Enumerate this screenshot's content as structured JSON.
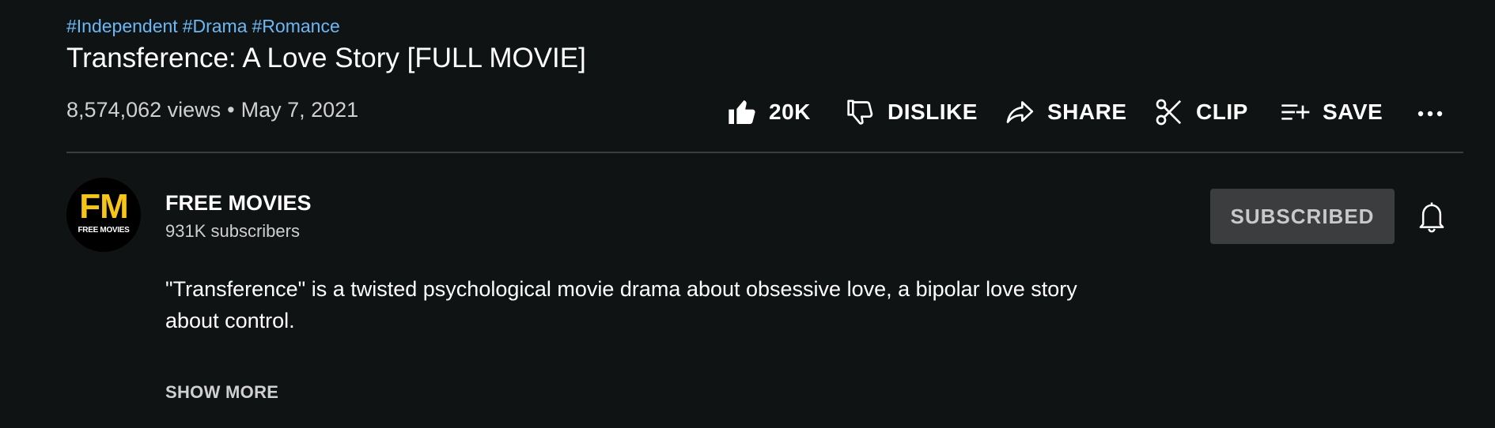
{
  "video": {
    "hashtags": [
      "#Independent",
      "#Drama",
      "#Romance"
    ],
    "title": "Transference: A Love Story [FULL MOVIE]",
    "views": "8,574,062 views",
    "separator": "•",
    "date": "May 7, 2021"
  },
  "actions": {
    "like": {
      "label": "20K",
      "icon": "thumbs-up-icon"
    },
    "dislike": {
      "label": "DISLIKE",
      "icon": "thumbs-down-icon"
    },
    "share": {
      "label": "SHARE",
      "icon": "share-arrow-icon"
    },
    "clip": {
      "label": "CLIP",
      "icon": "scissors-icon"
    },
    "save": {
      "label": "SAVE",
      "icon": "playlist-add-icon"
    },
    "more": {
      "icon": "more-horizontal-icon"
    }
  },
  "channel": {
    "avatar_text": "FM",
    "avatar_subtext": "FREE MOVIES",
    "name": "FREE MOVIES",
    "subscribers": "931K subscribers",
    "subscribe_label": "SUBSCRIBED",
    "bell_icon": "bell-icon"
  },
  "description": {
    "text": "\"Transference\" is a twisted psychological movie drama about obsessive love, a bipolar love story about control.",
    "show_more_label": "SHOW MORE"
  },
  "colors": {
    "background": "#101314",
    "hashtag": "#6ab8f5",
    "avatar_accent": "#f5c518",
    "subscribed_button": "#3b3d3f"
  }
}
